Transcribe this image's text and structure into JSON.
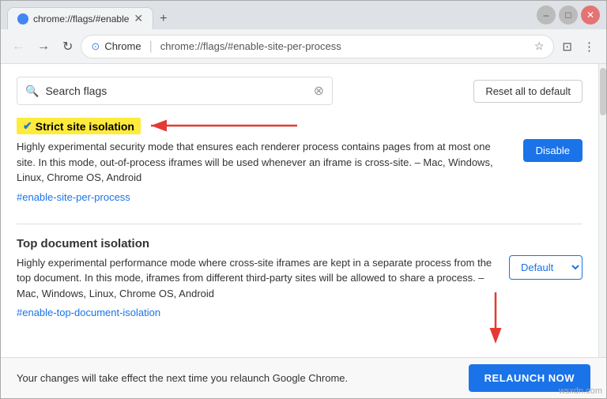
{
  "window": {
    "title": "chrome://flags/#enable"
  },
  "tab": {
    "label": "chrome://flags/#enable",
    "url": "chrome://flags/#enable-site-per-process"
  },
  "navbar": {
    "site_name": "Chrome",
    "url": "chrome://flags/#enable-site-per-process"
  },
  "search": {
    "placeholder": "Search flags",
    "value": "Search flags",
    "clear_label": "×"
  },
  "buttons": {
    "reset_all": "Reset all to default",
    "disable": "Disable",
    "relaunch": "RELAUNCH NOW"
  },
  "flags": [
    {
      "id": "strict-site-isolation",
      "title": "Strict site isolation",
      "description": "Highly experimental security mode that ensures each renderer process contains pages from at most one site. In this mode, out-of-process iframes will be used whenever an iframe is cross-site.  – Mac, Windows, Linux, Chrome OS, Android",
      "link_text": "#enable-site-per-process",
      "link_href": "#enable-site-per-process",
      "action": "disable",
      "badge": true
    },
    {
      "id": "top-document-isolation",
      "title": "Top document isolation",
      "description": "Highly experimental performance mode where cross-site iframes are kept in a separate process from the top document. In this mode, iframes from different third-party sites will be allowed to share a process.  – Mac, Windows, Linux, Chrome OS, Android",
      "link_text": "#enable-top-document-isolation",
      "link_href": "#enable-top-document-isolation",
      "action": "default",
      "badge": false
    }
  ],
  "bottom_bar": {
    "text": "Your changes will take effect the next time you relaunch Google Chrome."
  },
  "watermark": "wsxdn.com"
}
